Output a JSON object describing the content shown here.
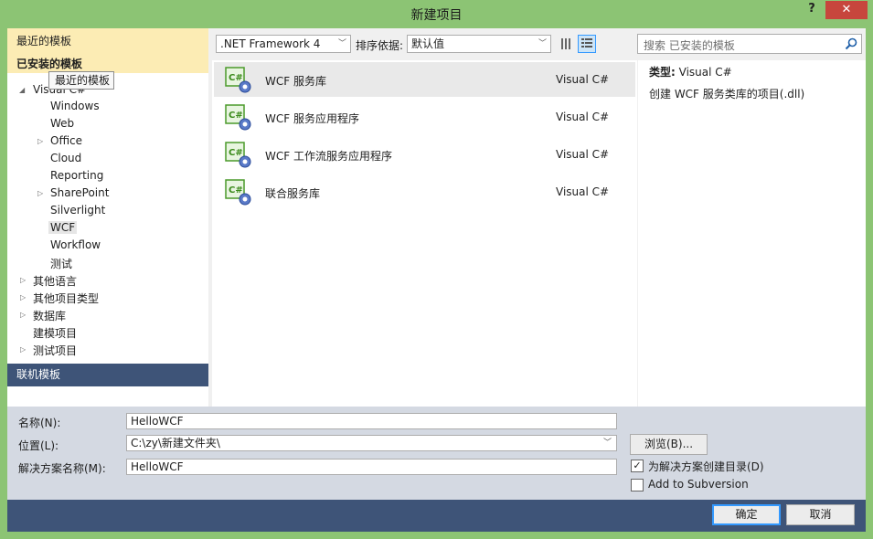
{
  "window": {
    "title": "新建项目",
    "help_label": "?",
    "close_label": "✕"
  },
  "sidebar": {
    "recent_label": "最近的模板",
    "installed_label": "已安装的模板",
    "tooltip": "最近的模板",
    "visual_cs_label": "Visual C#",
    "children": [
      "Windows",
      "Web",
      "Office",
      "Cloud",
      "Reporting",
      "SharePoint",
      "Silverlight",
      "WCF",
      "Workflow",
      "测试"
    ],
    "other_items": [
      "其他语言",
      "其他项目类型",
      "数据库",
      "建模项目",
      "测试项目"
    ],
    "online_label": "联机模板"
  },
  "toolbar": {
    "framework": ".NET Framework 4",
    "sort_label": "排序依据:",
    "sort_value": "默认值",
    "search_placeholder": "搜索 已安装的模板"
  },
  "templates": [
    {
      "name": "WCF 服务库",
      "lang": "Visual C#"
    },
    {
      "name": "WCF 服务应用程序",
      "lang": "Visual C#"
    },
    {
      "name": "WCF 工作流服务应用程序",
      "lang": "Visual C#"
    },
    {
      "name": "联合服务库",
      "lang": "Visual C#"
    }
  ],
  "details": {
    "type_label": "类型:",
    "type_value": "Visual C#",
    "description": "创建 WCF 服务类库的项目(.dll)"
  },
  "form": {
    "name_label": "名称(N):",
    "name_value": "HelloWCF",
    "location_label": "位置(L):",
    "location_value": "C:\\zy\\新建文件夹\\",
    "solution_label": "解决方案名称(M):",
    "solution_value": "HelloWCF",
    "browse_label": "浏览(B)...",
    "create_dir_label": "为解决方案创建目录(D)",
    "create_dir_checked": true,
    "svn_label": "Add to Subversion",
    "svn_checked": false,
    "ok_label": "确定",
    "cancel_label": "取消"
  },
  "colors": {
    "titlebar": "#8cc474",
    "close": "#c7463d",
    "accent": "#3e5478",
    "selected_header": "#fcecb4"
  }
}
